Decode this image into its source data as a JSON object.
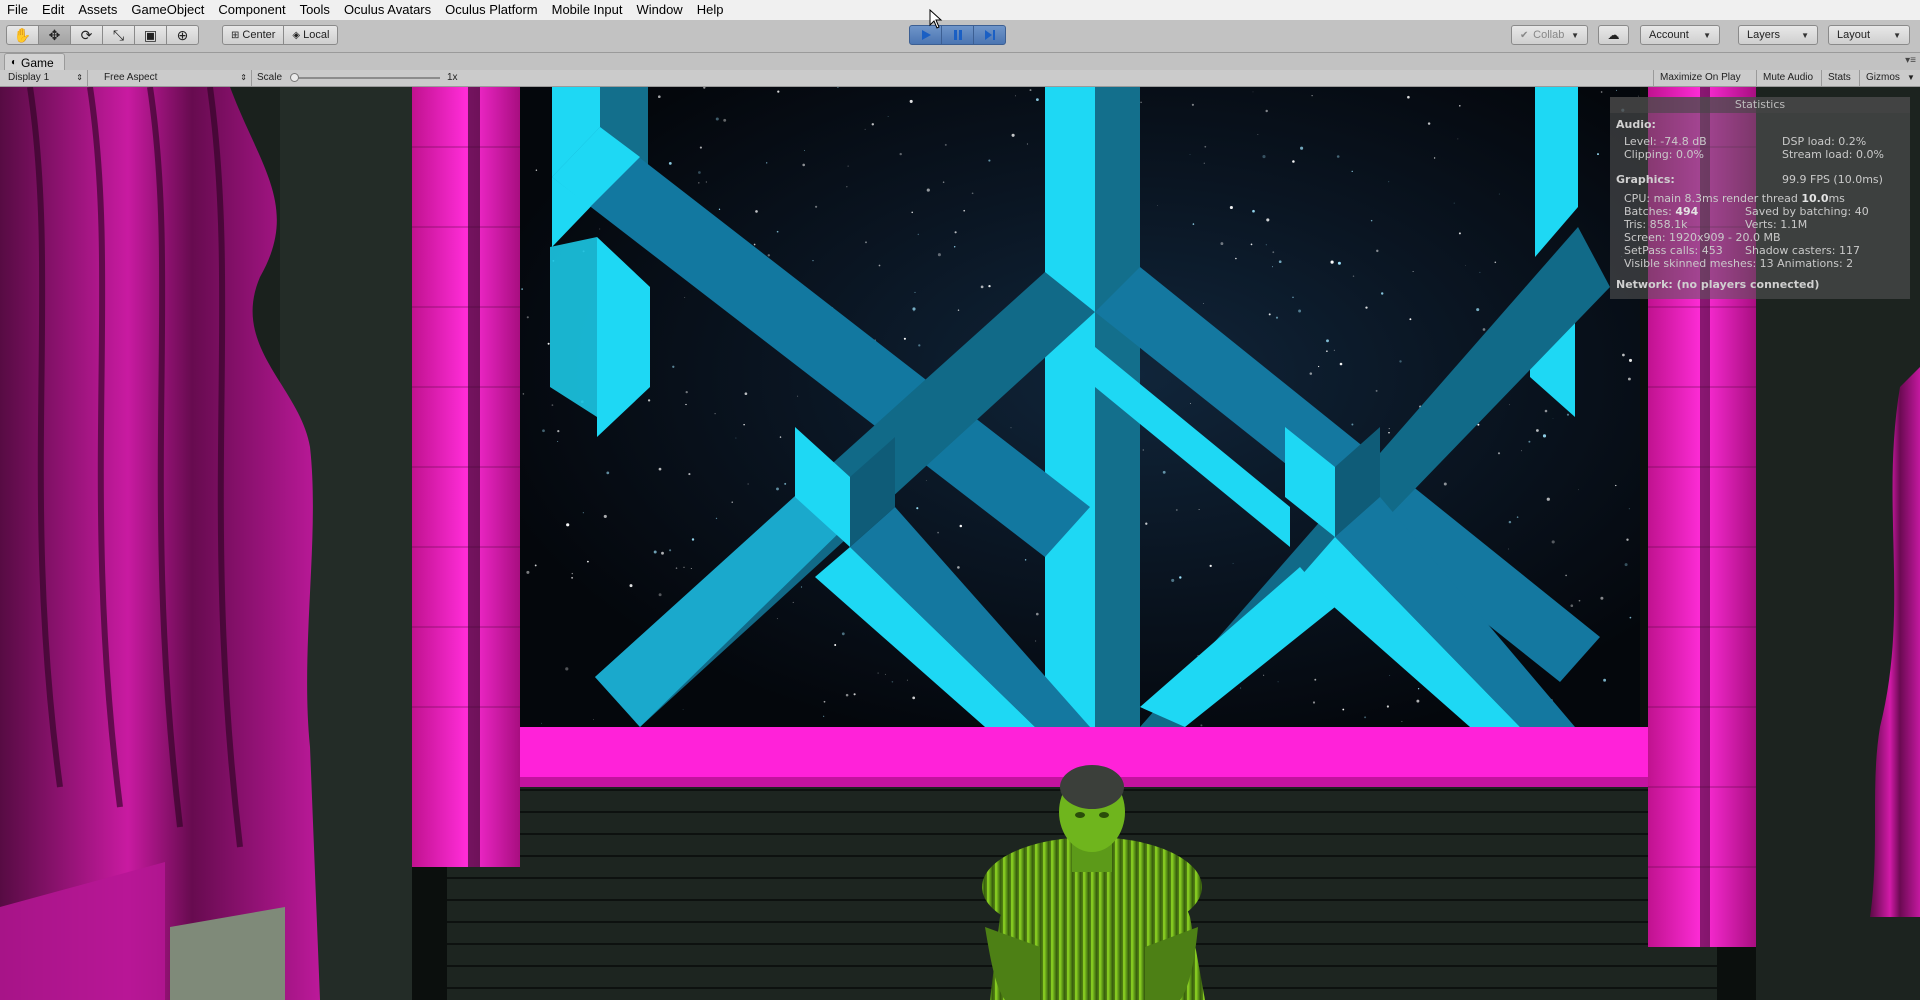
{
  "menu": [
    "File",
    "Edit",
    "Assets",
    "GameObject",
    "Component",
    "Tools",
    "Oculus Avatars",
    "Oculus Platform",
    "Mobile Input",
    "Window",
    "Help"
  ],
  "toolbar": {
    "tools": [
      {
        "name": "hand-tool-icon",
        "glyph": "✋"
      },
      {
        "name": "move-tool-icon",
        "glyph": "✥"
      },
      {
        "name": "rotate-tool-icon",
        "glyph": "⟳"
      },
      {
        "name": "scale-tool-icon",
        "glyph": "⤡"
      },
      {
        "name": "rect-tool-icon",
        "glyph": "▣"
      },
      {
        "name": "transform-tool-icon",
        "glyph": "⊕"
      }
    ],
    "pivot_mode": "Center",
    "pivot_rotation": "Local",
    "collab": "Collab",
    "account": "Account",
    "layers": "Layers",
    "layout": "Layout",
    "play_state": "playing"
  },
  "game_view": {
    "tab_label": "Game",
    "display": "Display 1",
    "aspect": "Free Aspect",
    "scale_label": "Scale",
    "scale_value": "1x",
    "scale_fraction": 0.0,
    "toggles": [
      "Maximize On Play",
      "Mute Audio",
      "Stats",
      "Gizmos"
    ]
  },
  "stats": {
    "title": "Statistics",
    "audio_header": "Audio:",
    "level": "Level: -74.8 dB",
    "dsp_load": "DSP load: 0.2%",
    "clipping": "Clipping: 0.0%",
    "stream_load": "Stream load: 0.0%",
    "graphics_header": "Graphics:",
    "fps": "99.9 FPS (10.0ms)",
    "cpu_prefix": "CPU: main 8.3ms  render thread ",
    "cpu_render": "10.0",
    "cpu_suffix": "ms",
    "batches_prefix": "Batches: ",
    "batches_value": "494",
    "saved_by_batching": "Saved by batching: 40",
    "tris": "Tris: 858.1k",
    "verts": "Verts: 1.1M",
    "screen": "Screen: 1920x909 - 20.0 MB",
    "setpass": "SetPass calls: 453",
    "shadow_casters": "Shadow casters: 117",
    "visible_skinned": "Visible skinned meshes: 13  Animations: 2",
    "network": "Network: (no players connected)"
  },
  "colors": {
    "magenta": "#ff1fd6",
    "cyan": "#1fd6f2",
    "dark_blue": "#116a88",
    "green_figure": "#7cc51e"
  }
}
